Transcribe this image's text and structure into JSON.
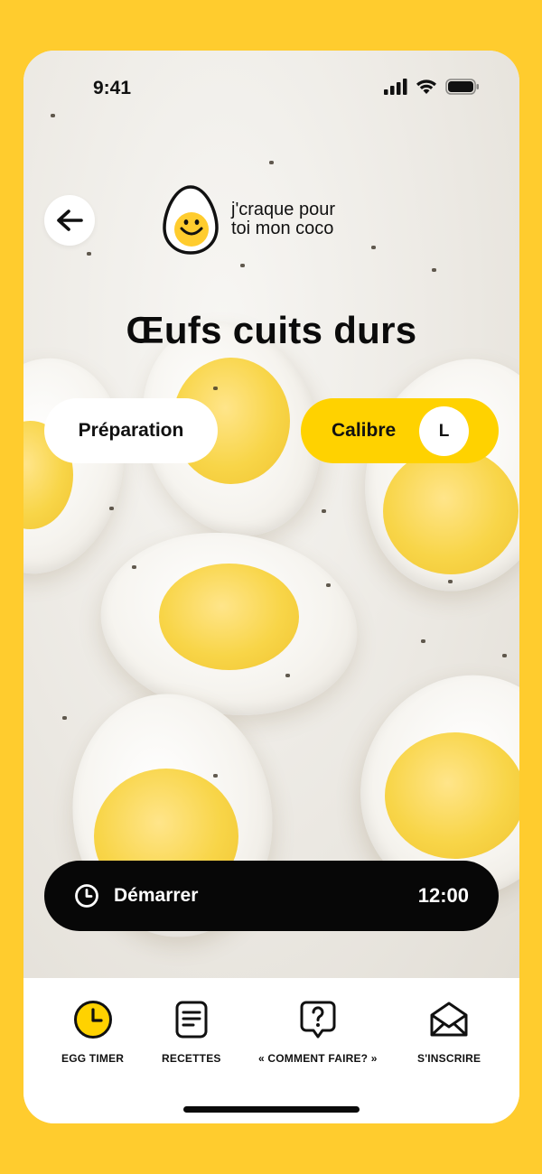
{
  "status": {
    "time": "9:41"
  },
  "header": {
    "back_icon": "arrow-left-icon",
    "logo_line1": "j'craque pour",
    "logo_line2": "toi mon coco"
  },
  "page_title": "Œufs cuits durs",
  "options": {
    "preparation_label": "Préparation",
    "calibre_label": "Calibre",
    "calibre_value": "L"
  },
  "timer": {
    "start_label": "Démarrer",
    "duration": "12:00"
  },
  "tabbar": {
    "items": [
      {
        "label": "EGG TIMER",
        "icon": "clock-icon",
        "active": true
      },
      {
        "label": "RECETTES",
        "icon": "document-icon",
        "active": false
      },
      {
        "label": "« COMMENT FAIRE? »",
        "icon": "question-bubble-icon",
        "active": false
      },
      {
        "label": "S'INSCRIRE",
        "icon": "envelope-icon",
        "active": false
      }
    ]
  },
  "colors": {
    "brand_yellow": "#FFCC2E",
    "accent_yellow": "#FFD200",
    "dark": "#070707"
  }
}
